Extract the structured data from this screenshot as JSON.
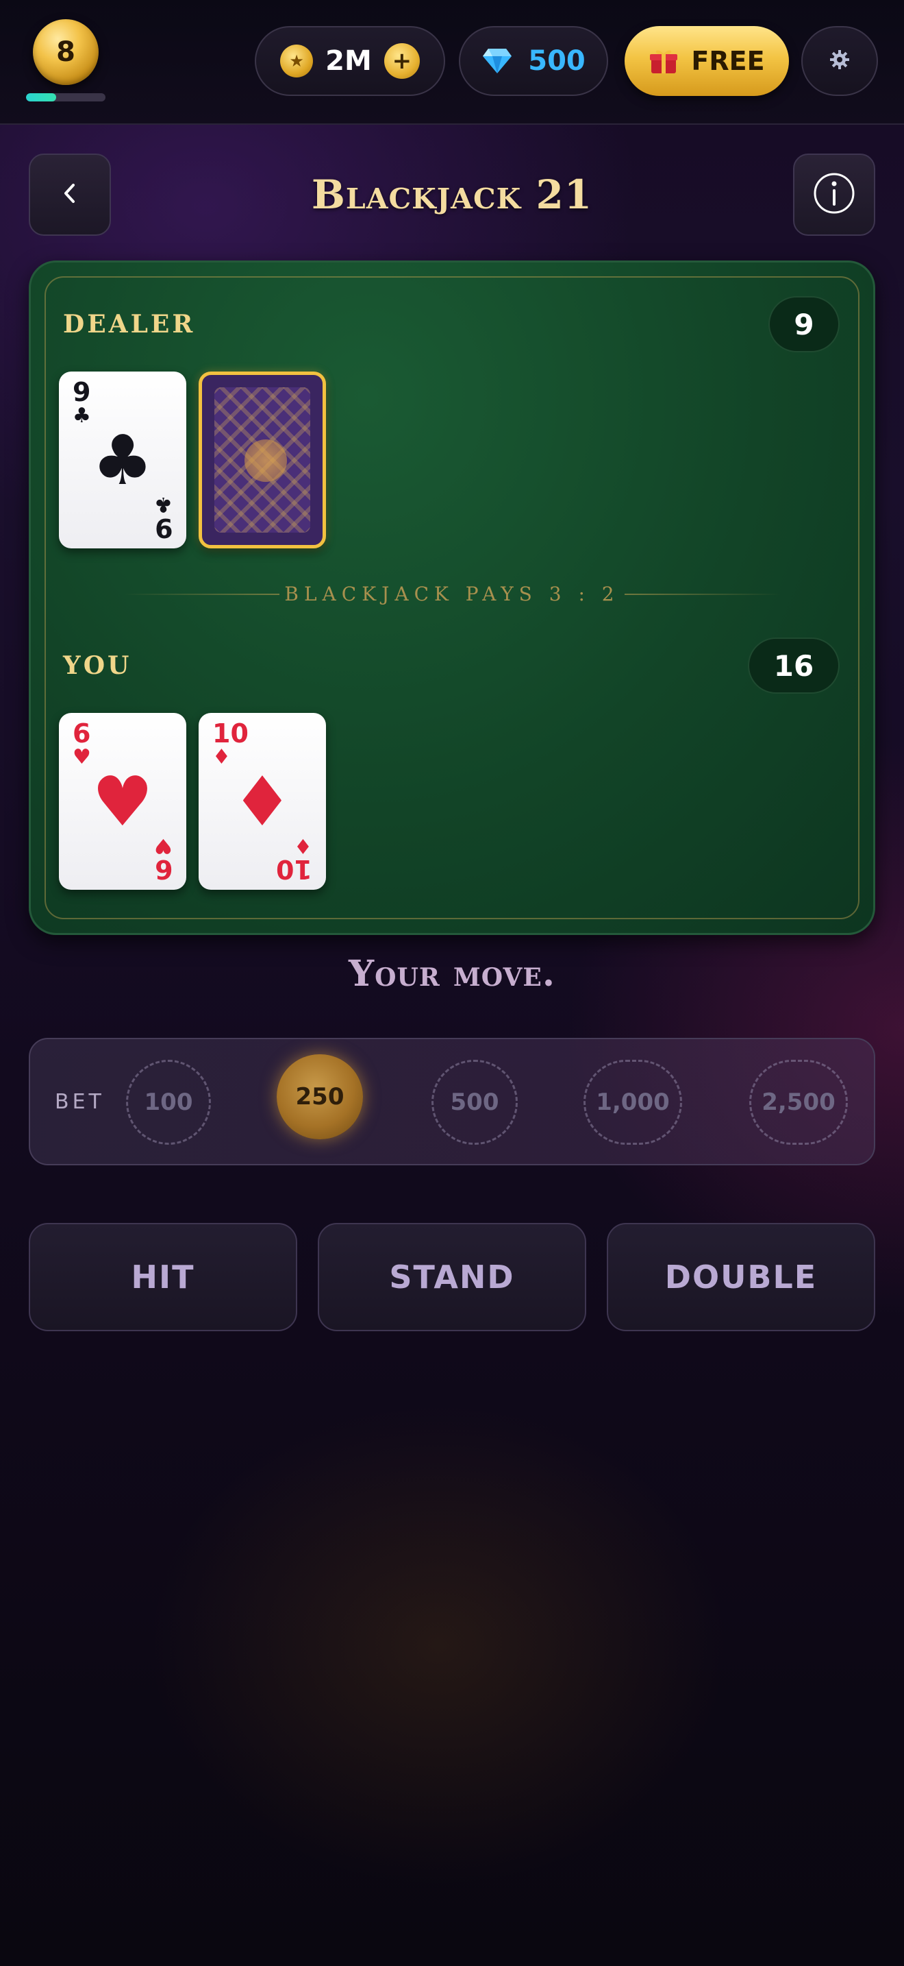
{
  "header": {
    "level": "8",
    "xp_progress_percent": 38,
    "coins": "2M",
    "coin_add_label": "+",
    "gems": "500",
    "free_label": "FREE",
    "icons": {
      "coin": "star-coin-icon",
      "gem": "diamond-gem-icon",
      "gift": "gift-icon",
      "settings": "gear-icon"
    }
  },
  "title_bar": {
    "title": "Blackjack 21",
    "back_icon": "chevron-left-icon",
    "info_icon": "info-icon"
  },
  "table": {
    "dealer": {
      "label": "DEALER",
      "score": "9",
      "cards": [
        {
          "rank": "9",
          "suit": "♣",
          "color": "black",
          "face_up": true
        },
        {
          "face_up": false
        }
      ]
    },
    "player": {
      "label": "YOU",
      "score": "16",
      "cards": [
        {
          "rank": "6",
          "suit": "♥",
          "color": "red",
          "face_up": true
        },
        {
          "rank": "10",
          "suit": "♦",
          "color": "red",
          "face_up": true
        }
      ]
    },
    "rule_text": "BLACKJACK PAYS 3 : 2"
  },
  "status": "Your move.",
  "bet": {
    "label": "BET",
    "chips": [
      "100",
      "250",
      "500",
      "1,000",
      "2,500"
    ],
    "selected": "250"
  },
  "actions": {
    "hit": "HIT",
    "stand": "STAND",
    "double": "DOUBLE"
  },
  "colors": {
    "felt": "#124427",
    "gold": "#f2c140",
    "gem_blue": "#39b7ff",
    "suit_red": "#e0243c"
  }
}
